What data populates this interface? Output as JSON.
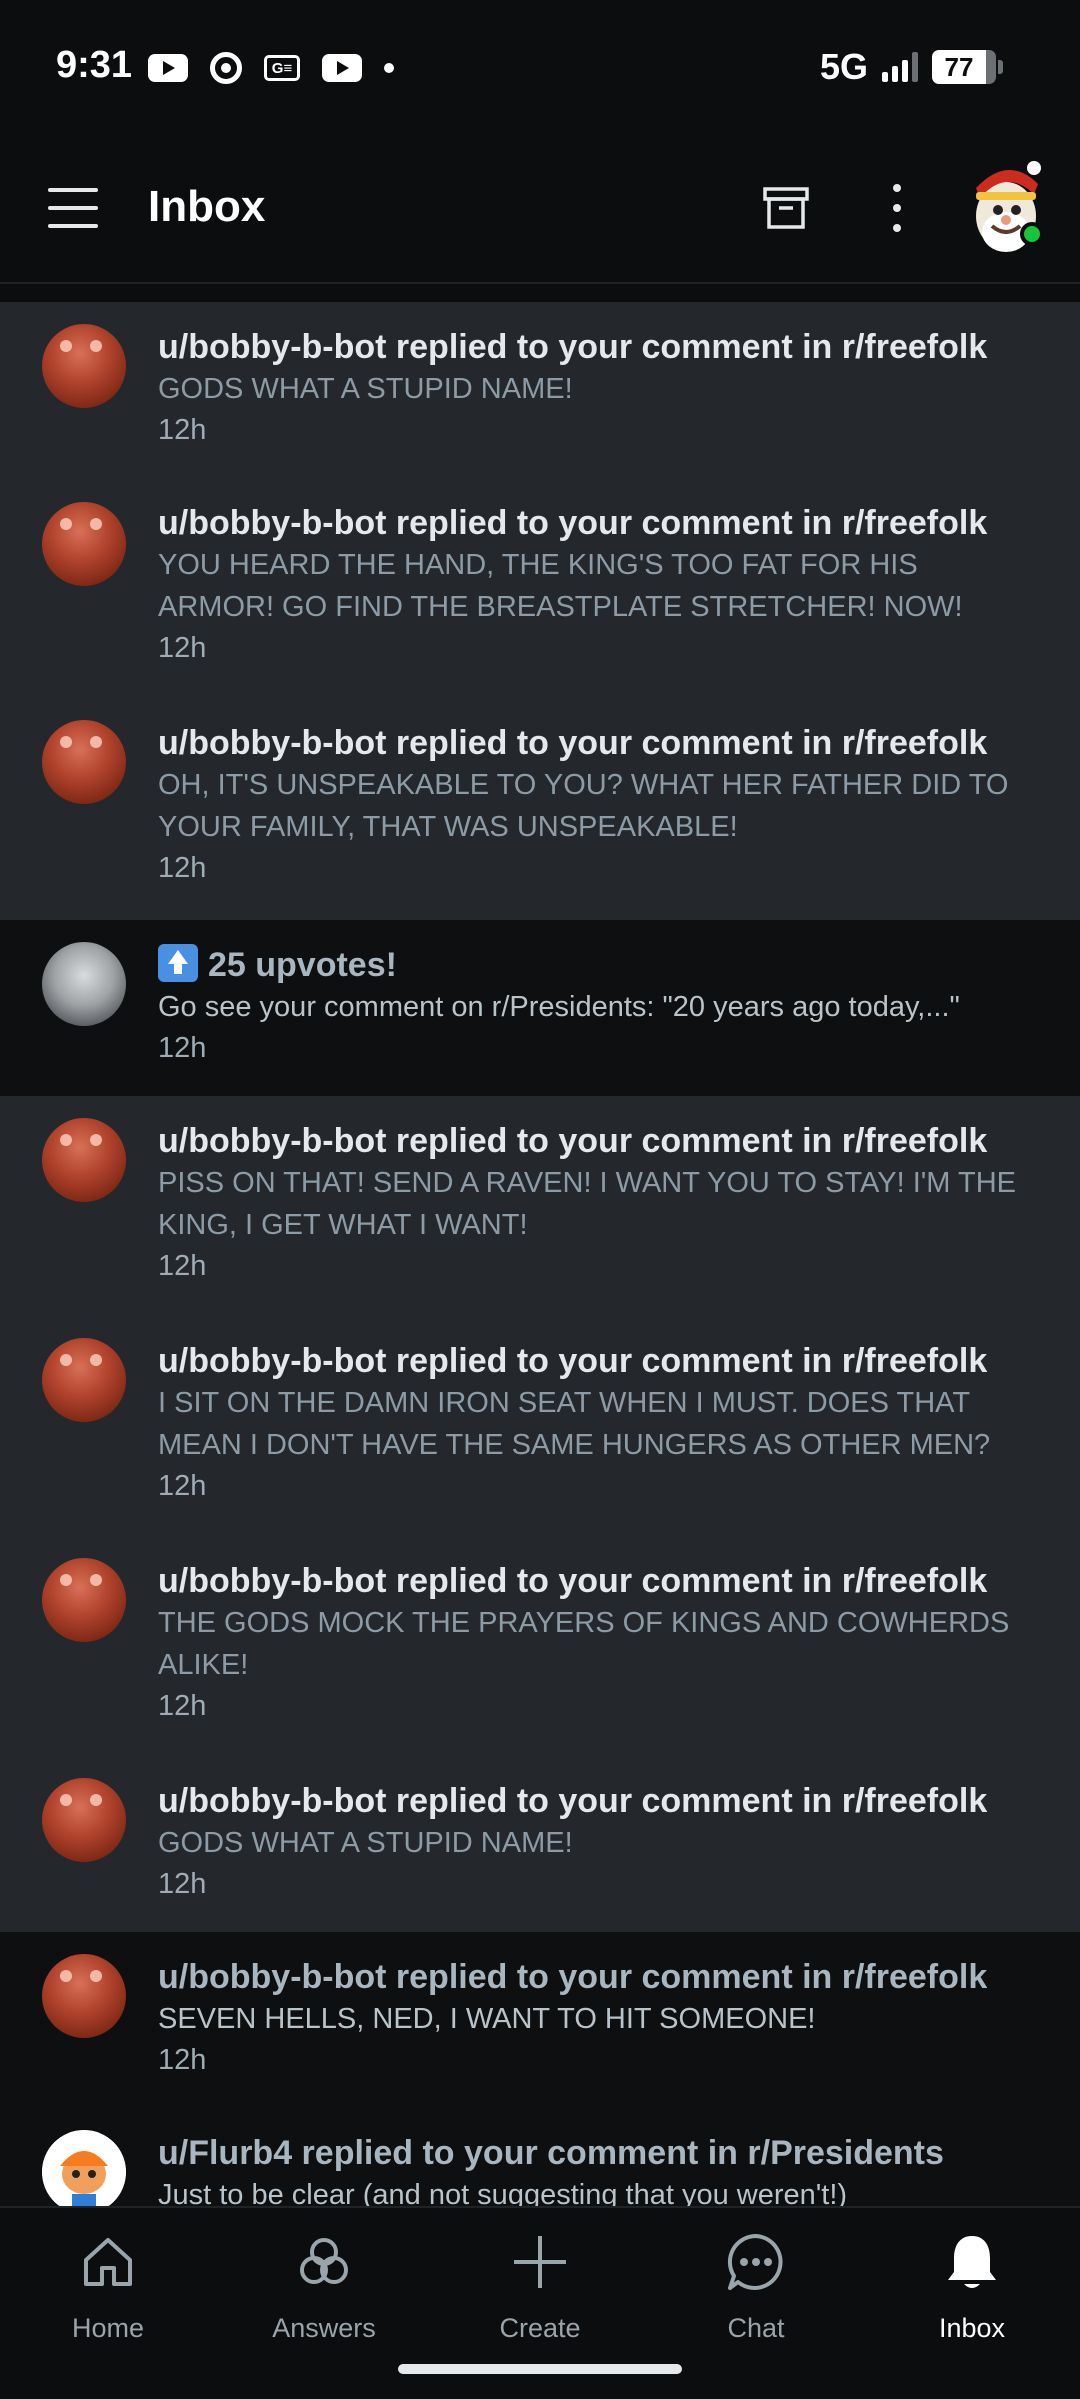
{
  "status_bar": {
    "time": "9:31",
    "network": "5G",
    "battery": "77",
    "icons": [
      "youtube-icon",
      "settings-icon",
      "news-icon",
      "youtube-icon",
      "dot-icon",
      "signal-icon",
      "battery-icon"
    ]
  },
  "app_bar": {
    "title": "Inbox",
    "icons": [
      "menu-icon",
      "archive-icon",
      "more-vertical-icon",
      "user-avatar"
    ]
  },
  "notifications": [
    {
      "state": "unread",
      "avatar": "bot-avatar",
      "headline": "u/bobby-b-bot replied to your comment in r/freefolk",
      "body": "GODS WHAT A STUPID NAME!",
      "time": "12h"
    },
    {
      "state": "unread",
      "avatar": "bot-avatar",
      "headline": "u/bobby-b-bot replied to your comment in r/freefolk",
      "body": "YOU HEARD THE HAND, THE KING'S TOO FAT FOR HIS ARMOR! GO FIND THE BREASTPLATE STRETCHER! NOW!",
      "time": "12h"
    },
    {
      "state": "unread",
      "avatar": "bot-avatar",
      "headline": "u/bobby-b-bot replied to your comment in r/freefolk",
      "body": "OH, IT'S UNSPEAKABLE TO YOU? WHAT HER FATHER DID TO YOUR FAMILY, THAT WAS UNSPEAKABLE!",
      "time": "12h"
    },
    {
      "state": "read",
      "avatar": "subreddit-avatar",
      "headline": "25 upvotes!",
      "body": "Go see your comment on r/Presidents: \"20 years ago today,...\"",
      "time": "12h"
    },
    {
      "state": "unread",
      "avatar": "bot-avatar",
      "headline": "u/bobby-b-bot replied to your comment in r/freefolk",
      "body": "PISS ON THAT! SEND A RAVEN! I WANT YOU TO STAY! I'M THE KING, I GET WHAT I WANT!",
      "time": "12h"
    },
    {
      "state": "unread",
      "avatar": "bot-avatar",
      "headline": "u/bobby-b-bot replied to your comment in r/freefolk",
      "body": "I SIT ON THE DAMN IRON SEAT WHEN I MUST. DOES THAT MEAN I DON'T HAVE THE SAME HUNGERS AS OTHER MEN?",
      "time": "12h"
    },
    {
      "state": "unread",
      "avatar": "bot-avatar",
      "headline": "u/bobby-b-bot replied to your comment in r/freefolk",
      "body": "THE GODS MOCK THE PRAYERS OF KINGS AND COWHERDS ALIKE!",
      "time": "12h"
    },
    {
      "state": "unread",
      "avatar": "bot-avatar",
      "headline": "u/bobby-b-bot replied to your comment in r/freefolk",
      "body": "GODS WHAT A STUPID NAME!",
      "time": "12h"
    },
    {
      "state": "read",
      "avatar": "bot-avatar",
      "headline": "u/bobby-b-bot replied to your comment in r/freefolk",
      "body": "SEVEN HELLS, NED, I WANT TO HIT SOMEONE!",
      "time": "12h"
    },
    {
      "state": "read",
      "avatar": "user-avatar",
      "headline": "u/Flurb4 replied to your comment in r/Presidents",
      "body": "Just to be clear (and not suggesting that you weren't!)",
      "time": ""
    }
  ],
  "bottom_nav": [
    {
      "label": "Home",
      "icon": "home-icon",
      "active": false
    },
    {
      "label": "Answers",
      "icon": "answers-icon",
      "active": false
    },
    {
      "label": "Create",
      "icon": "plus-icon",
      "active": false
    },
    {
      "label": "Chat",
      "icon": "chat-icon",
      "active": false
    },
    {
      "label": "Inbox",
      "icon": "bell-icon",
      "active": true
    }
  ],
  "colors": {
    "background": "#0b0d0f",
    "unread_row": "#24282c",
    "read_row": "#0d0f11",
    "online": "#19c43b",
    "upvote": "#4a90e2"
  }
}
